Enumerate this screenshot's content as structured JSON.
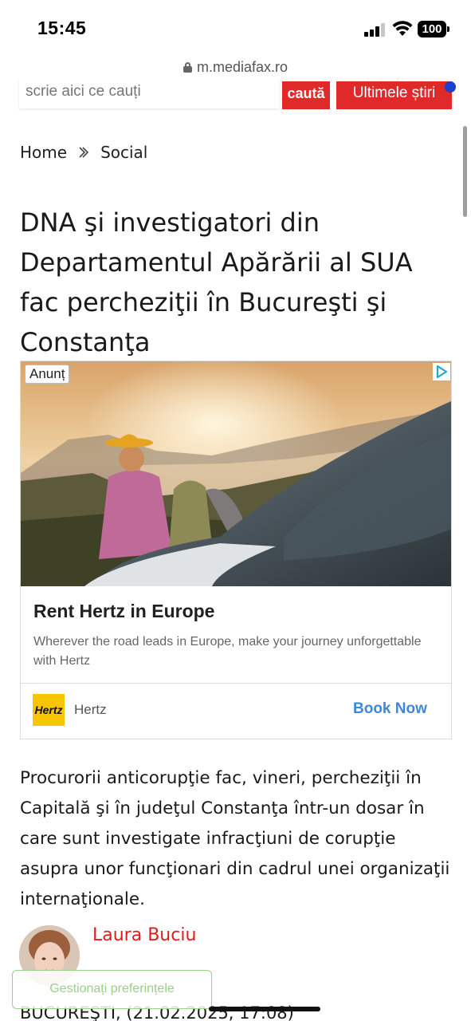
{
  "status_bar": {
    "time": "15:45",
    "battery": "100"
  },
  "browser": {
    "url": "m.mediafax.ro"
  },
  "header": {
    "search_placeholder": "scrie aici ce cauți",
    "search_button": "caută",
    "latest_button": "Ultimele știri",
    "accent_color": "#e02a2a"
  },
  "breadcrumb": {
    "home": "Home",
    "section": "Social"
  },
  "article": {
    "title": "DNA şi investigatori din Departamentul Apărării al SUA fac percheziţii în Bucureşti şi Constanţa",
    "lead": "Procurorii anticorupţie fac, vineri, percheziţii în Capitală şi în judeţul Constanţa într-un dosar în care sunt investigate infracţiuni de corupţie asupra unor funcţionari din cadrul unei organizaţii internaţionale.",
    "author": "Laura Buciu",
    "dateline": "BUCUREŞTI, (21.02.2025, 17:08)"
  },
  "ad": {
    "badge": "Anunț",
    "headline": "Rent Hertz in Europe",
    "description": "Wherever the road leads in Europe, make your journey unforgettable with Hertz",
    "advertiser_logo": "Hertz",
    "advertiser": "Hertz",
    "cta": "Book Now",
    "cta_color": "#3f87d9"
  },
  "cookie": {
    "label": "Gestionați preferințele"
  }
}
